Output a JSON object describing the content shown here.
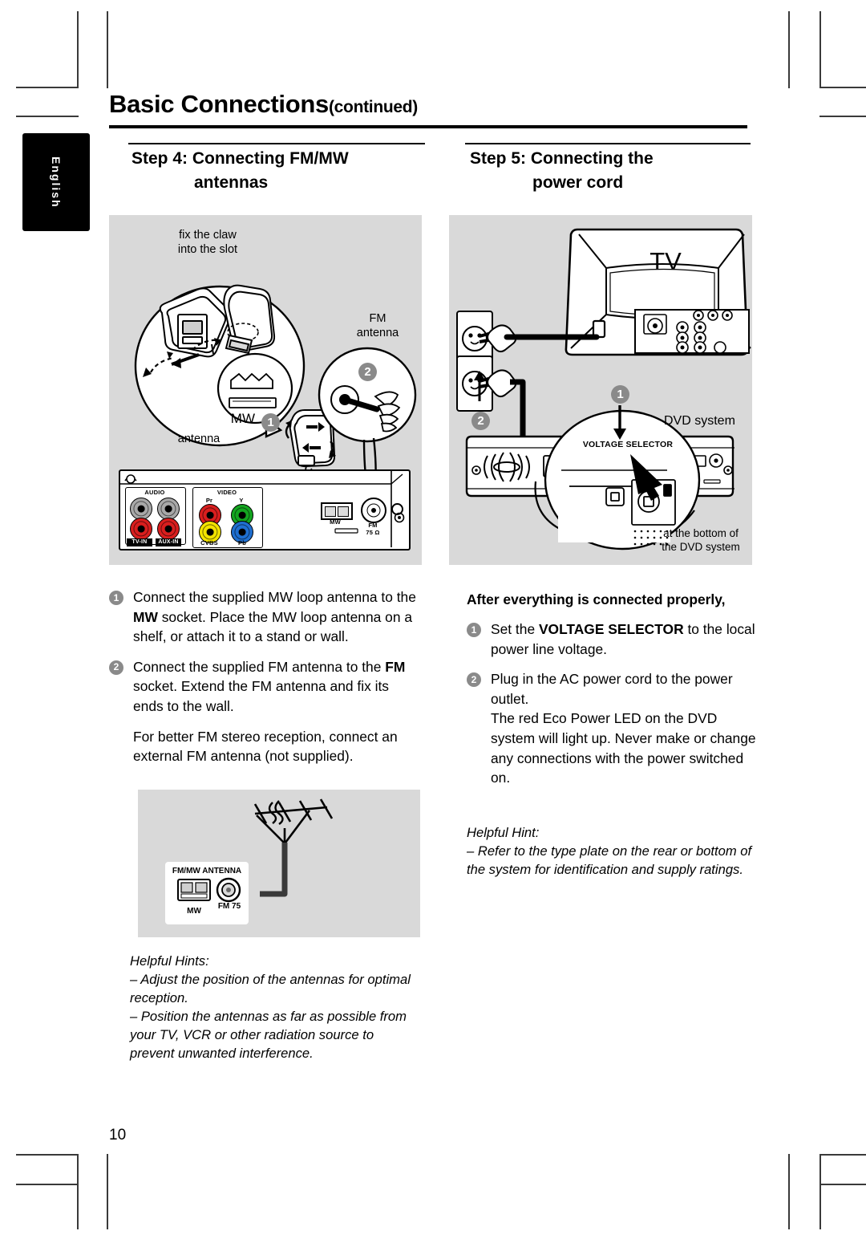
{
  "page": {
    "number": "10",
    "language_tab": "English",
    "title": "Basic Connections",
    "title_suffix": "(continued)"
  },
  "steps": [
    {
      "id": "step4",
      "line1": "Step 4: Connecting FM/MW",
      "line2": "antennas"
    },
    {
      "id": "step5",
      "line1": "Step 5: Connecting the",
      "line2": "power cord"
    }
  ],
  "figure_antenna": {
    "callout_line1": "fix the claw",
    "callout_line2": "into the slot",
    "fm_label_line1": "FM",
    "fm_label_line2": "antenna",
    "mw_label_line1": "MW",
    "mw_label_line2": "antenna",
    "badge_mw": "1",
    "badge_fm": "2",
    "panel": {
      "audio_label": "AUDIO",
      "video_label": "VIDEO",
      "jack_pr": "Pr",
      "jack_y": "Y",
      "jack_cvbs": "CVBS",
      "jack_pb": "Pb",
      "jack_tvin": "TV-IN",
      "jack_auxin": "AUX-IN",
      "mw_socket": "MW",
      "fm_socket_line1": "FM",
      "fm_socket_line2": "75 Ω"
    }
  },
  "figure_external_antenna": {
    "box_title": "FM/MW ANTENNA",
    "mw_label": "MW",
    "fm_label": "FM  75"
  },
  "figure_power": {
    "tv_label": "TV",
    "dvd_label": "DVD system",
    "voltage_selector_label": "VOLTAGE SELECTOR",
    "bottom_note_line1": "at the bottom of",
    "bottom_note_line2": "the DVD system",
    "badge_selector": "1",
    "badge_plug": "2"
  },
  "left_column": {
    "items": [
      {
        "num": "1",
        "html": "Connect the supplied MW loop antenna to the <b>MW</b> socket.  Place the MW loop antenna on a shelf, or attach it to a stand or wall."
      },
      {
        "num": "2",
        "html": "Connect the supplied FM antenna to the <b>FM</b> socket.  Extend the FM antenna and fix its ends to the wall."
      }
    ],
    "note": "For better FM stereo reception, connect an external FM antenna (not supplied).",
    "hint_title": "Helpful Hints:",
    "hints": [
      "–  Adjust the position of the antennas for optimal reception.",
      "–  Position the antennas as far as possible from your TV, VCR or other radiation source to prevent unwanted interference."
    ]
  },
  "right_column": {
    "subhead": "After everything is connected properly,",
    "items": [
      {
        "num": "1",
        "html": "Set the <b>VOLTAGE SELECTOR</b> to the local power line voltage."
      },
      {
        "num": "2",
        "html": "Plug in the AC power cord to the power outlet.<br>The red Eco Power LED on the DVD system will light up. Never make or change any connections with the power switched on."
      }
    ],
    "hint_title": "Helpful Hint:",
    "hints": [
      "–  Refer to the type plate on the rear or bottom of the system for identification and supply ratings."
    ]
  },
  "colors": {
    "figure_background": "#d9d9d9",
    "badge": "#8a8a8a",
    "jack_red": "#d81e1e",
    "jack_green": "#14a520",
    "jack_yellow": "#f2e200",
    "jack_blue": "#1f6fd0",
    "jack_grey": "#a8a8a8"
  }
}
